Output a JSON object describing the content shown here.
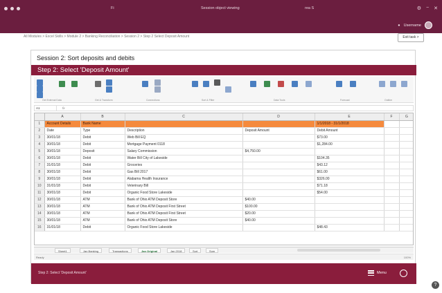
{
  "colors": {
    "brand": "#6b1e3f",
    "step_band": "#8a1d3c",
    "header_row": "#f58a3d",
    "excel_green": "#1f6b32"
  },
  "window": {
    "title_left": "Fi",
    "title_center": "Session object viewing",
    "title_right": "rea S",
    "user_name": "Username"
  },
  "breadcrumb": "All Modules > Excel Skills > Module 2 > Banking Reconciliation > Session 2 > Step 2 Select Deposit Amount",
  "exit_label": "Exit task >",
  "section_title": "Session 2: Sort deposits and debits",
  "step_title": "Step 2: Select 'Deposit Amount'",
  "ribbon": {
    "groups": [
      "Get External Data",
      "Get & Transform",
      "Connections",
      "Sort & Filter",
      "Data Tools",
      "Forecast",
      "Outline"
    ]
  },
  "formula_bar": {
    "name_box": "A1",
    "fx": "fx"
  },
  "columns": [
    "A",
    "B",
    "C",
    "D",
    "E",
    "F",
    "G"
  ],
  "rows": [
    {
      "n": "1",
      "a": "Account Details",
      "b": "Bank Name",
      "c": "",
      "d": "",
      "e": "1/1/2018 - 31/1/2018",
      "header": true
    },
    {
      "n": "2",
      "a": "Date",
      "b": "Type",
      "c": "Description",
      "d": "Deposit Amount",
      "e": "Debit Amount"
    },
    {
      "n": "3",
      "a": "30/01/18",
      "b": "Debit",
      "c": "Web Bill EQ",
      "d": "",
      "e": "$73.00"
    },
    {
      "n": "4",
      "a": "30/01/18",
      "b": "Debit",
      "c": "Mortgage Payment 0118",
      "d": "",
      "e": "$1,284.00"
    },
    {
      "n": "5",
      "a": "30/01/18",
      "b": "Deposit",
      "c": "Salary Commission",
      "d": "$4,750.00",
      "e": ""
    },
    {
      "n": "6",
      "a": "30/01/18",
      "b": "Debit",
      "c": "Water Bill City of Lakeside",
      "d": "",
      "e": "$104.35"
    },
    {
      "n": "7",
      "a": "31/01/18",
      "b": "Debit",
      "c": "Groceries",
      "d": "",
      "e": "$43.12"
    },
    {
      "n": "8",
      "a": "30/01/18",
      "b": "Debit",
      "c": "Gas Bill 2017",
      "d": "",
      "e": "$61.00"
    },
    {
      "n": "9",
      "a": "30/01/18",
      "b": "Debit",
      "c": "Alabama Health Insurance",
      "d": "",
      "e": "$326.00"
    },
    {
      "n": "10",
      "a": "31/01/18",
      "b": "Debit",
      "c": "Veterinary Bill",
      "d": "",
      "e": "$71.18"
    },
    {
      "n": "11",
      "a": "30/01/18",
      "b": "Debit",
      "c": "Organic Food Store Lakeside",
      "d": "",
      "e": "$54.00"
    },
    {
      "n": "12",
      "a": "30/01/18",
      "b": "ATM",
      "c": "Bank of Ohio ATM Deposit Store",
      "d": "$40.00",
      "e": ""
    },
    {
      "n": "13",
      "a": "30/01/18",
      "b": "ATM",
      "c": "Bank of Ohio ATM Deposit First Street",
      "d": "$100.00",
      "e": ""
    },
    {
      "n": "14",
      "a": "30/01/18",
      "b": "ATM",
      "c": "Bank of Ohio ATM Deposit First Street",
      "d": "$20.00",
      "e": ""
    },
    {
      "n": "15",
      "a": "30/01/18",
      "b": "ATM",
      "c": "Bank of Ohio ATM Deposit Store",
      "d": "$40.00",
      "e": ""
    },
    {
      "n": "16",
      "a": "31/01/18",
      "b": "Debit",
      "c": "Organic Food Store Lakeside",
      "d": "",
      "e": "$48.43"
    }
  ],
  "sheet_tabs": [
    "Sheet1",
    "Jan Banking",
    "Transactions",
    "Jan Original",
    "Jan 2018",
    "Sort",
    "Sum"
  ],
  "status_text": "Ready",
  "zoom": "100%",
  "footer": {
    "step_label": "Step 2: Select 'Deposit Amount'",
    "menu_label": "Menu"
  },
  "help_label": "?"
}
